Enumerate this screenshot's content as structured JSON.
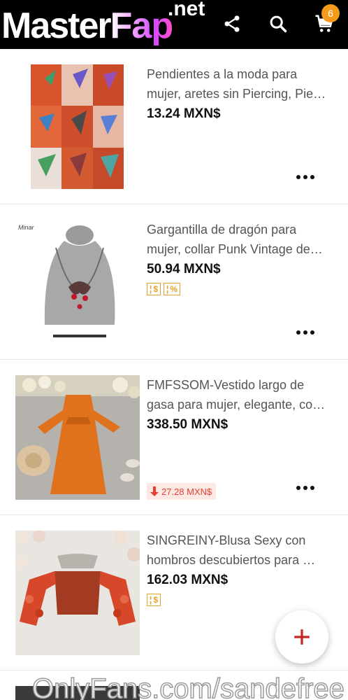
{
  "header": {
    "logo_main": "Master",
    "logo_accent": "Fap",
    "logo_suffix": ".net",
    "icons": [
      "share-icon",
      "search-icon",
      "cart-icon"
    ],
    "cart_count": "6",
    "colors": {
      "bar": "#000000",
      "badge": "#f59a1b"
    }
  },
  "products": [
    {
      "title": "Pendientes a la moda para mujer, aretes sin Piercing, Pie…",
      "price": "13.24 MXN$",
      "tags": [],
      "price_drop": ""
    },
    {
      "brand_mark": "Minar",
      "title": "Gargantilla de dragón para mujer, collar Punk Vintage de…",
      "price": "50.94 MXN$",
      "tags": [
        "$",
        "%"
      ],
      "price_drop": ""
    },
    {
      "title": "FMFSSOM-Vestido largo de gasa para mujer, elegante, co…",
      "price": "338.50 MXN$",
      "tags": [],
      "price_drop": "27.28 MXN$"
    },
    {
      "title": "SINGREINY-Blusa Sexy con hombros descubiertos para …",
      "price": "162.03 MXN$",
      "tags": [
        "$"
      ],
      "price_drop": ""
    }
  ],
  "fab": {
    "icon": "plus-icon",
    "color": "#c62828"
  },
  "watermark": "OnlyFans.com/sandefree"
}
